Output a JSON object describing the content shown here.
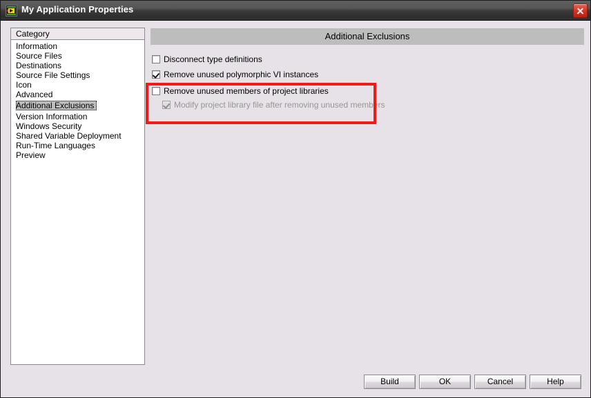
{
  "window": {
    "title": "My Application Properties",
    "icon": "labview-vi-icon",
    "close_label": "close-icon"
  },
  "sidebar": {
    "header": "Category",
    "items": [
      {
        "label": "Information",
        "selected": false
      },
      {
        "label": "Source Files",
        "selected": false
      },
      {
        "label": "Destinations",
        "selected": false
      },
      {
        "label": "Source File Settings",
        "selected": false
      },
      {
        "label": "Icon",
        "selected": false
      },
      {
        "label": "Advanced",
        "selected": false
      },
      {
        "label": "Additional Exclusions",
        "selected": true
      },
      {
        "label": "Version Information",
        "selected": false
      },
      {
        "label": "Windows Security",
        "selected": false
      },
      {
        "label": "Shared Variable Deployment",
        "selected": false
      },
      {
        "label": "Run-Time Languages",
        "selected": false
      },
      {
        "label": "Preview",
        "selected": false
      }
    ]
  },
  "panel": {
    "header": "Additional Exclusions",
    "options": [
      {
        "label": "Disconnect type definitions",
        "checked": false,
        "disabled": false
      },
      {
        "label": "Remove unused polymorphic VI instances",
        "checked": true,
        "disabled": false
      },
      {
        "label": "Remove unused members of project libraries",
        "checked": false,
        "disabled": false
      },
      {
        "label": "Modify project library file after removing unused members",
        "checked": true,
        "disabled": true
      }
    ]
  },
  "annotation": {
    "color": "#ef1b1b"
  },
  "buttons": {
    "build": "Build",
    "ok": "OK",
    "cancel": "Cancel",
    "help": "Help"
  },
  "colors": {
    "dialog_background": "#e7e2e7",
    "panel_header": "#bdbdbd",
    "selection": "#bdbdbd",
    "titlebar_dark": "#2d2d2d",
    "close_red": "#d9382a",
    "annotation_red": "#ef1b1b"
  }
}
